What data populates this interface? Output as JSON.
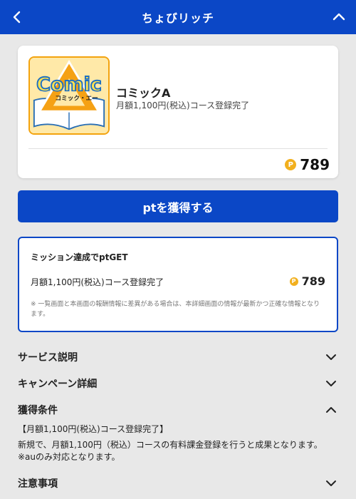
{
  "header": {
    "title": "ちょびリッチ",
    "back_icon": "chevron-left-icon",
    "collapse_icon": "chevron-up-icon",
    "background": "#0b47c6"
  },
  "service": {
    "logo": {
      "word": "Comic",
      "sub": "コミック・エー"
    },
    "name": "コミックA",
    "condition": "月額1,100円(税込)コース登録完了",
    "coin_symbol": "P",
    "points": "789"
  },
  "get_button": {
    "label": "ptを獲得する"
  },
  "mission": {
    "title": "ミッション達成でptGET",
    "condition": "月額1,100円(税込)コース登録完了",
    "coin_symbol": "P",
    "points": "789",
    "note": "※ 一覧画面と本画面の報酬情報に差異がある場合は、本詳細画面の情報が最新かつ正確な情報となります。"
  },
  "sections": {
    "service_desc": "サービス説明",
    "campaign": "キャンペーン詳細",
    "conditions": "獲得条件",
    "notes": "注意事項"
  },
  "conditions_body": {
    "line1": "【月額1,100円(税込)コース登録完了】",
    "line2": "新規で、月額1,100円（税込）コースの有料課金登録を行うと成果となります。",
    "line3": "※auのみ対応となります。"
  },
  "colors": {
    "accent": "#0b47c6",
    "coin": "#f2b01e",
    "logo_border": "#f3a30e"
  }
}
